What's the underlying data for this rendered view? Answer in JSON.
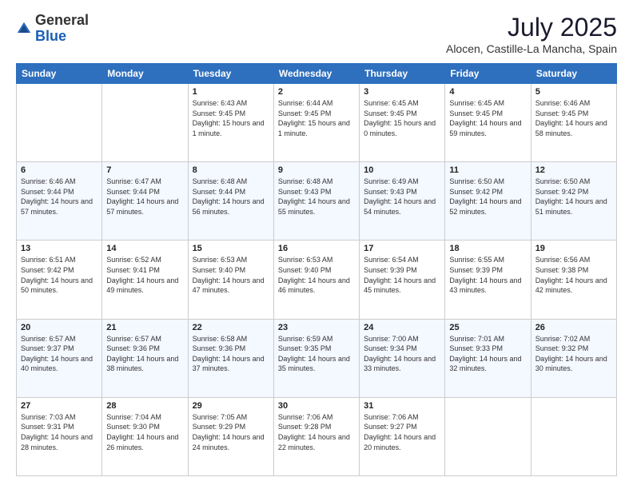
{
  "header": {
    "logo_line1": "General",
    "logo_line2": "Blue",
    "month": "July 2025",
    "location": "Alocen, Castille-La Mancha, Spain"
  },
  "weekdays": [
    "Sunday",
    "Monday",
    "Tuesday",
    "Wednesday",
    "Thursday",
    "Friday",
    "Saturday"
  ],
  "weeks": [
    [
      {
        "day": "",
        "info": ""
      },
      {
        "day": "",
        "info": ""
      },
      {
        "day": "1",
        "info": "Sunrise: 6:43 AM\nSunset: 9:45 PM\nDaylight: 15 hours\nand 1 minute."
      },
      {
        "day": "2",
        "info": "Sunrise: 6:44 AM\nSunset: 9:45 PM\nDaylight: 15 hours\nand 1 minute."
      },
      {
        "day": "3",
        "info": "Sunrise: 6:45 AM\nSunset: 9:45 PM\nDaylight: 15 hours\nand 0 minutes."
      },
      {
        "day": "4",
        "info": "Sunrise: 6:45 AM\nSunset: 9:45 PM\nDaylight: 14 hours\nand 59 minutes."
      },
      {
        "day": "5",
        "info": "Sunrise: 6:46 AM\nSunset: 9:45 PM\nDaylight: 14 hours\nand 58 minutes."
      }
    ],
    [
      {
        "day": "6",
        "info": "Sunrise: 6:46 AM\nSunset: 9:44 PM\nDaylight: 14 hours\nand 57 minutes."
      },
      {
        "day": "7",
        "info": "Sunrise: 6:47 AM\nSunset: 9:44 PM\nDaylight: 14 hours\nand 57 minutes."
      },
      {
        "day": "8",
        "info": "Sunrise: 6:48 AM\nSunset: 9:44 PM\nDaylight: 14 hours\nand 56 minutes."
      },
      {
        "day": "9",
        "info": "Sunrise: 6:48 AM\nSunset: 9:43 PM\nDaylight: 14 hours\nand 55 minutes."
      },
      {
        "day": "10",
        "info": "Sunrise: 6:49 AM\nSunset: 9:43 PM\nDaylight: 14 hours\nand 54 minutes."
      },
      {
        "day": "11",
        "info": "Sunrise: 6:50 AM\nSunset: 9:42 PM\nDaylight: 14 hours\nand 52 minutes."
      },
      {
        "day": "12",
        "info": "Sunrise: 6:50 AM\nSunset: 9:42 PM\nDaylight: 14 hours\nand 51 minutes."
      }
    ],
    [
      {
        "day": "13",
        "info": "Sunrise: 6:51 AM\nSunset: 9:42 PM\nDaylight: 14 hours\nand 50 minutes."
      },
      {
        "day": "14",
        "info": "Sunrise: 6:52 AM\nSunset: 9:41 PM\nDaylight: 14 hours\nand 49 minutes."
      },
      {
        "day": "15",
        "info": "Sunrise: 6:53 AM\nSunset: 9:40 PM\nDaylight: 14 hours\nand 47 minutes."
      },
      {
        "day": "16",
        "info": "Sunrise: 6:53 AM\nSunset: 9:40 PM\nDaylight: 14 hours\nand 46 minutes."
      },
      {
        "day": "17",
        "info": "Sunrise: 6:54 AM\nSunset: 9:39 PM\nDaylight: 14 hours\nand 45 minutes."
      },
      {
        "day": "18",
        "info": "Sunrise: 6:55 AM\nSunset: 9:39 PM\nDaylight: 14 hours\nand 43 minutes."
      },
      {
        "day": "19",
        "info": "Sunrise: 6:56 AM\nSunset: 9:38 PM\nDaylight: 14 hours\nand 42 minutes."
      }
    ],
    [
      {
        "day": "20",
        "info": "Sunrise: 6:57 AM\nSunset: 9:37 PM\nDaylight: 14 hours\nand 40 minutes."
      },
      {
        "day": "21",
        "info": "Sunrise: 6:57 AM\nSunset: 9:36 PM\nDaylight: 14 hours\nand 38 minutes."
      },
      {
        "day": "22",
        "info": "Sunrise: 6:58 AM\nSunset: 9:36 PM\nDaylight: 14 hours\nand 37 minutes."
      },
      {
        "day": "23",
        "info": "Sunrise: 6:59 AM\nSunset: 9:35 PM\nDaylight: 14 hours\nand 35 minutes."
      },
      {
        "day": "24",
        "info": "Sunrise: 7:00 AM\nSunset: 9:34 PM\nDaylight: 14 hours\nand 33 minutes."
      },
      {
        "day": "25",
        "info": "Sunrise: 7:01 AM\nSunset: 9:33 PM\nDaylight: 14 hours\nand 32 minutes."
      },
      {
        "day": "26",
        "info": "Sunrise: 7:02 AM\nSunset: 9:32 PM\nDaylight: 14 hours\nand 30 minutes."
      }
    ],
    [
      {
        "day": "27",
        "info": "Sunrise: 7:03 AM\nSunset: 9:31 PM\nDaylight: 14 hours\nand 28 minutes."
      },
      {
        "day": "28",
        "info": "Sunrise: 7:04 AM\nSunset: 9:30 PM\nDaylight: 14 hours\nand 26 minutes."
      },
      {
        "day": "29",
        "info": "Sunrise: 7:05 AM\nSunset: 9:29 PM\nDaylight: 14 hours\nand 24 minutes."
      },
      {
        "day": "30",
        "info": "Sunrise: 7:06 AM\nSunset: 9:28 PM\nDaylight: 14 hours\nand 22 minutes."
      },
      {
        "day": "31",
        "info": "Sunrise: 7:06 AM\nSunset: 9:27 PM\nDaylight: 14 hours\nand 20 minutes."
      },
      {
        "day": "",
        "info": ""
      },
      {
        "day": "",
        "info": ""
      }
    ]
  ]
}
